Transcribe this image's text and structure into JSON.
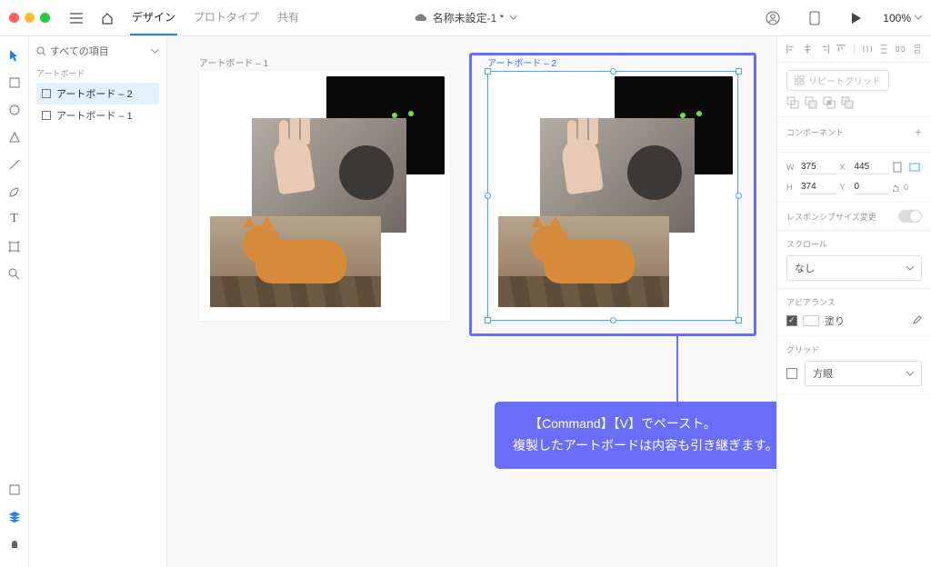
{
  "header": {
    "tabs": {
      "design": "デザイン",
      "prototype": "プロトタイプ",
      "share": "共有"
    },
    "title": "名称未設定-1 *",
    "zoom": "100%"
  },
  "left": {
    "search_label": "すべての項目",
    "section_artboards": "アートボード",
    "items": [
      {
        "label": "アートボード – 2"
      },
      {
        "label": "アートボード – 1"
      }
    ]
  },
  "canvas": {
    "artboard1_label": "アートボード – 1",
    "artboard2_label": "アートボード – 2"
  },
  "callout": {
    "line1": "【Command】【V】でペースト。",
    "line2": "複製したアートボードは内容も引き継ぎます。"
  },
  "right": {
    "repeat_grid": "リピートグリッド",
    "component_label": "コンポーネント",
    "w_label": "W",
    "w_val": "375",
    "x_label": "X",
    "x_val": "445",
    "h_label": "H",
    "h_val": "374",
    "y_label": "Y",
    "y_val": "0",
    "rotate_icon_val": "0",
    "responsive_label": "レスポンシブサイズ変更",
    "scroll_label": "スクロール",
    "scroll_value": "なし",
    "appearance_label": "アピアランス",
    "fill_label": "塗り",
    "grid_label": "グリッド",
    "grid_value": "方眼"
  }
}
